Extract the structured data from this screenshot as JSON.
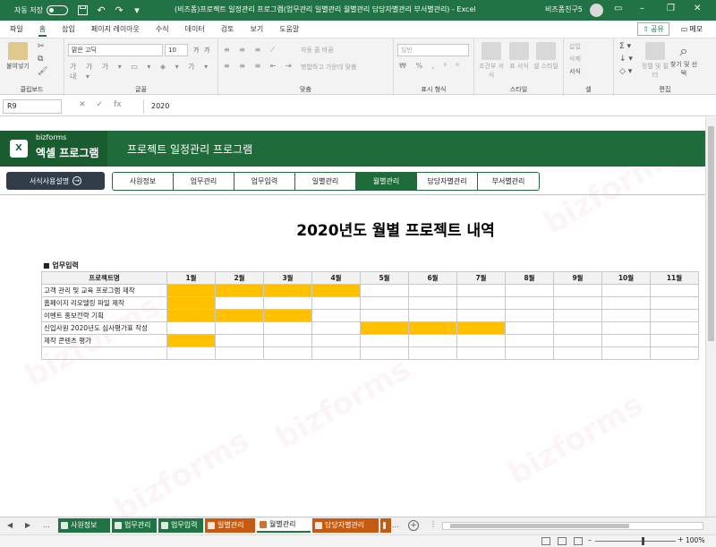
{
  "titlebar": {
    "autosave_label": "자동 저장",
    "autosave_state": "끔",
    "title": "(비즈폼)프로젝트 일정관리 프로그램(업무관리 일별관리 월별관리 담당자별관리 부서별관리)  -  Excel",
    "user": "비즈폼친구5"
  },
  "ribbon": {
    "tabs": [
      "파일",
      "홈",
      "삽입",
      "페이지 레이아웃",
      "수식",
      "데이터",
      "검토",
      "보기",
      "도움말"
    ],
    "active_tab": "홈",
    "share_label": "공유",
    "memo_label": "메모",
    "groups": {
      "clipboard": "클립보드",
      "font": "글꼴",
      "alignment": "맞춤",
      "number": "표시 형식",
      "styles": "스타일",
      "cells": "셀",
      "editing": "편집"
    },
    "paste_label": "붙여넣기",
    "font_name": "맑은 고딕",
    "font_size": "10",
    "wrap_text": "자동 줄 바꿈",
    "merge_center": "병합하고 가운데 맞춤",
    "number_format": "일반",
    "conditional_format": "조건부 서식",
    "format_table": "표 서식",
    "cell_styles": "셀 스타일",
    "insert": "삽입",
    "delete": "삭제",
    "format": "서식",
    "sort_filter": "정렬 및 필터",
    "find_select": "찾기 및 선택"
  },
  "formula_bar": {
    "cell_ref": "R9",
    "fx": "fx",
    "value": "2020"
  },
  "sheet": {
    "brand": "bizforms",
    "product": "엑셀 프로그램",
    "app_title": "프로젝트 일정관리 프로그램",
    "guide_button": "서식사용설명",
    "nav": [
      "사원정보",
      "업무관리",
      "업무입력",
      "일별관리",
      "월별관리",
      "담당자별관리",
      "부서별관리"
    ],
    "active_nav": "월별관리",
    "report_title": "2020년도 월별 프로젝트 내역",
    "section_label": "■ 업무입력",
    "table": {
      "headers": [
        "프로젝트명",
        "1월",
        "2월",
        "3월",
        "4월",
        "5월",
        "6월",
        "7월",
        "8월",
        "9월",
        "10월",
        "11월"
      ],
      "rows": [
        {
          "name": "고객 관리 및 교육 프로그램 제작",
          "months": [
            1,
            1,
            1,
            1,
            0,
            0,
            0,
            0,
            0,
            0,
            0
          ]
        },
        {
          "name": "홈페이지 리모델링 파일 제작",
          "months": [
            1,
            0,
            0,
            0,
            0,
            0,
            0,
            0,
            0,
            0,
            0
          ]
        },
        {
          "name": "이벤트 홍보전략 기획",
          "months": [
            1,
            1,
            1,
            0,
            0,
            0,
            0,
            0,
            0,
            0,
            0
          ]
        },
        {
          "name": "신입사원 2020년도 심사평가표 작성",
          "months": [
            0,
            0,
            0,
            0,
            1,
            1,
            1,
            0,
            0,
            0,
            0
          ]
        },
        {
          "name": "제작 콘텐츠 평가",
          "months": [
            1,
            0,
            0,
            0,
            0,
            0,
            0,
            0,
            0,
            0,
            0
          ]
        },
        {
          "name": "",
          "months": [
            0,
            0,
            0,
            0,
            0,
            0,
            0,
            0,
            0,
            0,
            0
          ]
        }
      ],
      "highlight_color": "#ffc000"
    },
    "watermark": "bizforms"
  },
  "sheet_tabs": {
    "items": [
      {
        "label": "사원정보",
        "color": "#217346"
      },
      {
        "label": "업무관리",
        "color": "#217346"
      },
      {
        "label": "업무입력",
        "color": "#217346"
      },
      {
        "label": "일별관리",
        "color": "#c55a11"
      },
      {
        "label": "월별관리",
        "color": "#c55a11"
      },
      {
        "label": "담당자별관리",
        "color": "#c55a11"
      },
      {
        "label": "",
        "color": "#c55a11"
      }
    ],
    "active": "월별관리",
    "ellipsis": "..."
  },
  "statusbar": {
    "zoom": "100%"
  }
}
